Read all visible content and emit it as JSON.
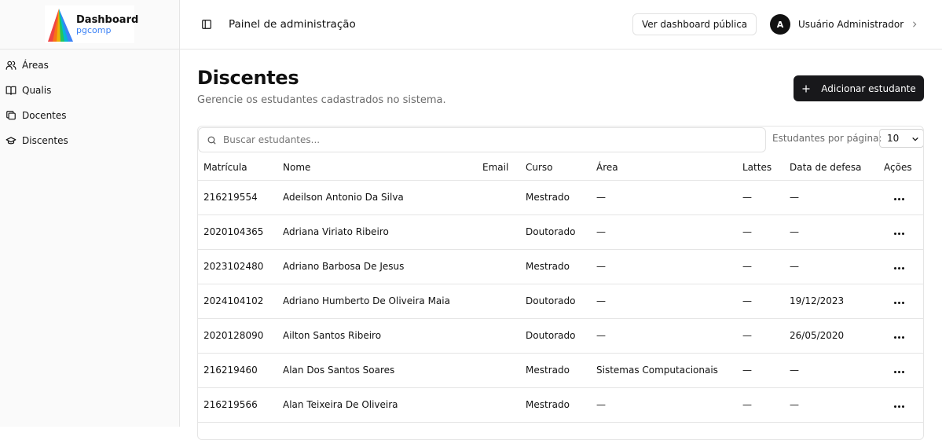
{
  "logo": {
    "title": "Dashboard",
    "subtitle": "pgcomp"
  },
  "sidebar": {
    "items": [
      {
        "label": "Áreas",
        "icon": "users-icon"
      },
      {
        "label": "Qualis",
        "icon": "book-open-icon"
      },
      {
        "label": "Docentes",
        "icon": "docs-icon"
      },
      {
        "label": "Discentes",
        "icon": "graduation-cap-icon"
      }
    ]
  },
  "header": {
    "title": "Painel de administração",
    "public_button": "Ver dashboard pública",
    "user": {
      "initial": "A",
      "name": "Usuário Administrador"
    }
  },
  "page": {
    "title": "Discentes",
    "subtitle": "Gerencie os estudantes cadastrados no sistema.",
    "add_button": "Adicionar estudante"
  },
  "table": {
    "search_placeholder": "Buscar estudantes...",
    "per_page_label": "Estudantes por página:",
    "per_page_value": "10",
    "columns": [
      "Matrícula",
      "Nome",
      "Email",
      "Curso",
      "Área",
      "Lattes",
      "Data de defesa",
      "Ações"
    ],
    "rows": [
      {
        "matricula": "216219554",
        "nome": "Adeilson Antonio Da Silva",
        "email": "",
        "curso": "Mestrado",
        "area": "—",
        "lattes": "—",
        "defesa": "—"
      },
      {
        "matricula": "2020104365",
        "nome": "Adriana Viriato Ribeiro",
        "email": "",
        "curso": "Doutorado",
        "area": "—",
        "lattes": "—",
        "defesa": "—"
      },
      {
        "matricula": "2023102480",
        "nome": "Adriano Barbosa De Jesus",
        "email": "",
        "curso": "Mestrado",
        "area": "—",
        "lattes": "—",
        "defesa": "—"
      },
      {
        "matricula": "2024104102",
        "nome": "Adriano Humberto De Oliveira Maia",
        "email": "",
        "curso": "Doutorado",
        "area": "—",
        "lattes": "—",
        "defesa": "19/12/2023"
      },
      {
        "matricula": "2020128090",
        "nome": "Ailton Santos Ribeiro",
        "email": "",
        "curso": "Doutorado",
        "area": "—",
        "lattes": "—",
        "defesa": "26/05/2020"
      },
      {
        "matricula": "216219460",
        "nome": "Alan Dos Santos Soares",
        "email": "",
        "curso": "Mestrado",
        "area": "Sistemas Computacionais",
        "lattes": "—",
        "defesa": "—"
      },
      {
        "matricula": "216219566",
        "nome": "Alan Teixeira De Oliveira",
        "email": "",
        "curso": "Mestrado",
        "area": "—",
        "lattes": "—",
        "defesa": "—"
      }
    ]
  },
  "colors": {
    "primary": "#18181b",
    "border": "#e5e5e5",
    "muted_text": "#6b6b6b",
    "logo_sub": "#3b82f6"
  }
}
